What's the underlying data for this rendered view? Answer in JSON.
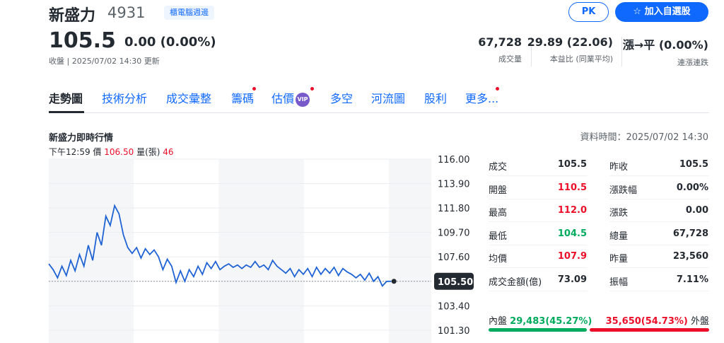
{
  "header": {
    "name": "新盛力",
    "code": "4931",
    "tag": "櫃電腦週邊",
    "pk_label": "PK",
    "add_label": "加入自選股",
    "price": "105.5",
    "change": "0.00 (0.00%)",
    "status": "收盤 | 2025/07/02 14:30 更新",
    "stats": [
      {
        "value": "67,728",
        "label": "成交量"
      },
      {
        "value": "29.89 (22.06)",
        "label": "本益比 (同業平均)"
      },
      {
        "value": "漲→平 (0.00%)",
        "label": "連漲連跌"
      }
    ]
  },
  "tabs": [
    {
      "label": "走勢圖",
      "active": true
    },
    {
      "label": "技術分析"
    },
    {
      "label": "成交彙整"
    },
    {
      "label": "籌碼",
      "dot": true
    },
    {
      "label": "估價",
      "vip": "VIP",
      "dot": true
    },
    {
      "label": "多空"
    },
    {
      "label": "河流圖"
    },
    {
      "label": "股利"
    },
    {
      "label": "更多...",
      "dot": true
    }
  ],
  "chart_section": {
    "title": "新盛力即時行情",
    "data_time": "資料時間：2025/07/02 14:30",
    "tooltip_time": "下午12:59",
    "tooltip_price_label": "價",
    "tooltip_price": "106.50",
    "tooltip_vol_label": "量(張)",
    "tooltip_vol": "46"
  },
  "colors": {
    "up": "#eb0f29",
    "down": "#00ab5e",
    "line": "#1f63d4",
    "accent": "#0f69ff"
  },
  "chart_data": {
    "type": "line",
    "ylim": [
      100.2,
      116.0
    ],
    "yticks": [
      "116.00",
      "113.90",
      "111.80",
      "109.70",
      "107.60",
      "105.50",
      "103.40",
      "101.30"
    ],
    "ytick_values": [
      116.0,
      113.9,
      111.8,
      109.7,
      107.6,
      105.5,
      103.4,
      101.3
    ],
    "reference_price": 105.5,
    "current_label": "105.50",
    "y": [
      107.0,
      106.5,
      105.8,
      106.8,
      106.0,
      107.3,
      106.4,
      107.8,
      106.8,
      108.6,
      107.3,
      109.7,
      108.6,
      111.1,
      110.3,
      112.0,
      111.3,
      109.5,
      108.4,
      107.9,
      108.4,
      107.5,
      108.3,
      107.8,
      108.2,
      107.6,
      106.5,
      107.4,
      106.8,
      105.4,
      106.4,
      105.5,
      106.5,
      105.9,
      106.8,
      106.1,
      107.1,
      106.6,
      107.2,
      106.5,
      106.8,
      107.0,
      106.7,
      106.9,
      106.6,
      106.9,
      106.7,
      107.2,
      106.7,
      106.9,
      106.5,
      107.3,
      106.8,
      106.5,
      106.2,
      106.6,
      105.9,
      106.5,
      106.1,
      106.6,
      105.9,
      106.7,
      106.1,
      106.6,
      106.2,
      106.7,
      106.0,
      106.6,
      106.3,
      106.1,
      105.8,
      106.1,
      105.6,
      106.2,
      105.5,
      105.9,
      105.1,
      105.5,
      105.5
    ],
    "total_points": 90
  },
  "stats_table": {
    "left": [
      {
        "label": "成交",
        "value": "105.5",
        "color": ""
      },
      {
        "label": "開盤",
        "value": "110.5",
        "color": "up"
      },
      {
        "label": "最高",
        "value": "112.0",
        "color": "up"
      },
      {
        "label": "最低",
        "value": "104.5",
        "color": "down"
      },
      {
        "label": "均價",
        "value": "107.9",
        "color": "up"
      },
      {
        "label": "成交金額(億)",
        "value": "73.09",
        "color": ""
      }
    ],
    "right": [
      {
        "label": "昨收",
        "value": "105.5"
      },
      {
        "label": "漲跌幅",
        "value": "0.00%"
      },
      {
        "label": "漲跌",
        "value": "0.00"
      },
      {
        "label": "總量",
        "value": "67,728"
      },
      {
        "label": "昨量",
        "value": "23,560"
      },
      {
        "label": "振幅",
        "value": "7.11%"
      }
    ]
  },
  "inner_outer": {
    "inner_label": "內盤",
    "inner_value": "29,483(45.27%)",
    "outer_value": "35,650(54.73%)",
    "outer_label": "外盤",
    "inner_pct": 45.27
  }
}
